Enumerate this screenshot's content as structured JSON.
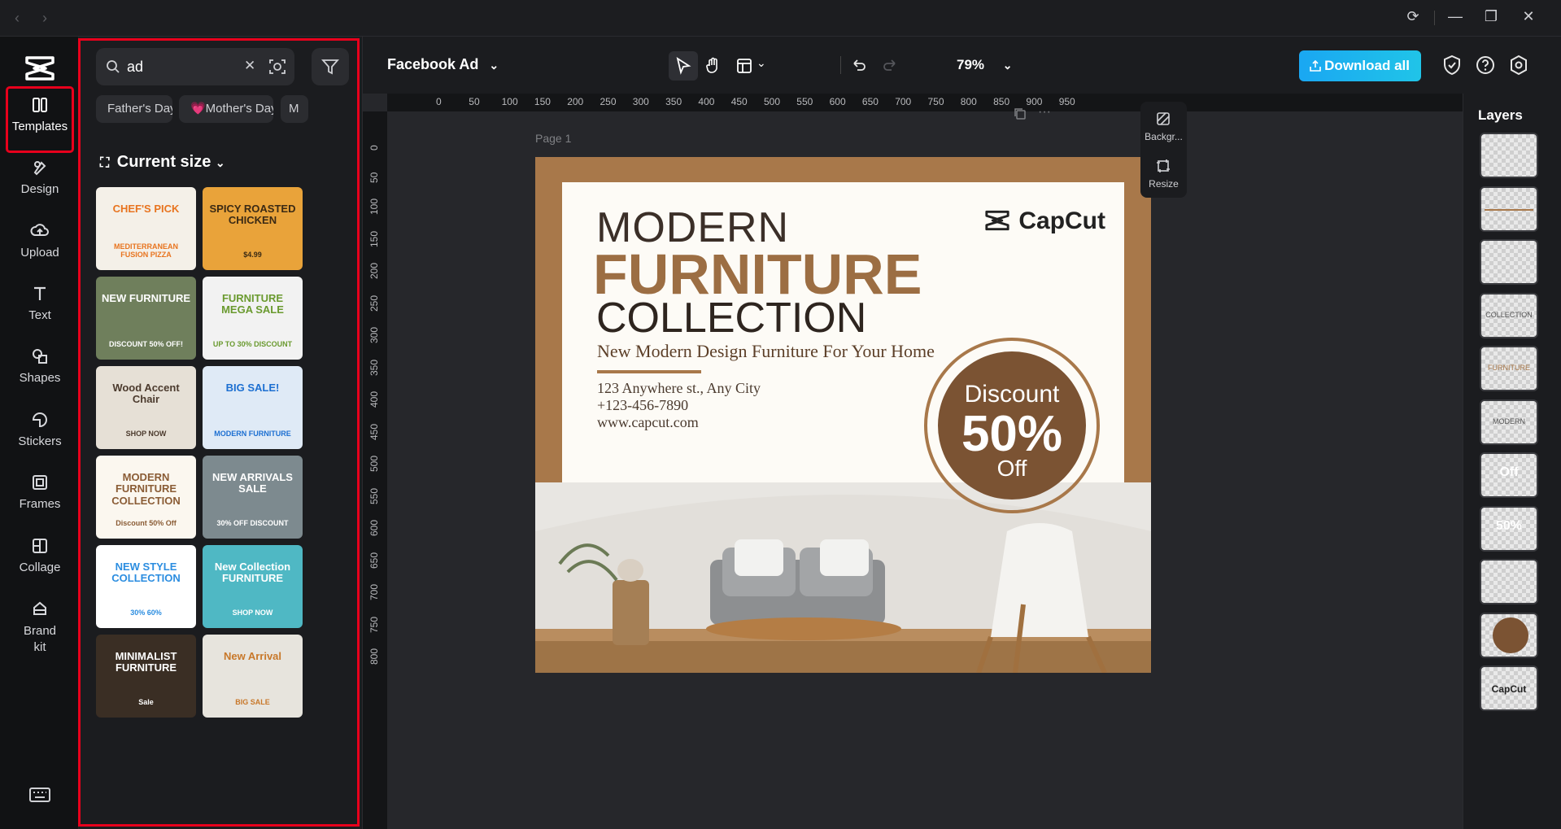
{
  "window": {
    "nav_back": "‹",
    "nav_forward": "›",
    "controls": [
      "refresh-icon",
      "minimize-icon",
      "restore-icon",
      "close-icon"
    ]
  },
  "rail": {
    "items": [
      {
        "label": "Templates",
        "icon": "templates-icon",
        "active": true
      },
      {
        "label": "Design",
        "icon": "design-icon"
      },
      {
        "label": "Upload",
        "icon": "upload-icon"
      },
      {
        "label": "Text",
        "icon": "text-icon"
      },
      {
        "label": "Shapes",
        "icon": "shapes-icon"
      },
      {
        "label": "Stickers",
        "icon": "stickers-icon"
      },
      {
        "label": "Frames",
        "icon": "frames-icon"
      },
      {
        "label": "Collage",
        "icon": "collage-icon"
      },
      {
        "label": "Brand kit",
        "icon": "brand-kit-icon"
      }
    ]
  },
  "panel": {
    "search_value": "ad",
    "chips": [
      "Father's Day",
      "💗Mother's Day",
      "M"
    ],
    "section_title": "Current size",
    "templates": [
      {
        "title": "CHEF'S PICK",
        "sub": "MEDITERRANEAN FUSION PIZZA",
        "bg": "#f4f0e8",
        "accent": "#e8741f"
      },
      {
        "title": "SPICY ROASTED CHICKEN",
        "sub": "$4.99",
        "bg": "#e9a33a",
        "accent": "#3b2a14"
      },
      {
        "title": "NEW FURNITURE",
        "sub": "DISCOUNT 50% OFF!",
        "bg": "#6f7f5c",
        "accent": "#ffffff"
      },
      {
        "title": "FURNITURE MEGA SALE",
        "sub": "UP TO 30% DISCOUNT",
        "bg": "#f2f2f2",
        "accent": "#6a9a2f"
      },
      {
        "title": "Wood Accent Chair",
        "sub": "SHOP NOW",
        "bg": "#e6e0d6",
        "accent": "#4b3a2d"
      },
      {
        "title": "BIG SALE!",
        "sub": "MODERN FURNITURE",
        "bg": "#dfeaf6",
        "accent": "#1c6fd1"
      },
      {
        "title": "MODERN FURNITURE COLLECTION",
        "sub": "Discount 50% Off",
        "bg": "#fbf7ef",
        "accent": "#8a5c35"
      },
      {
        "title": "NEW ARRIVALS SALE",
        "sub": "30% OFF DISCOUNT",
        "bg": "#7d8a8f",
        "accent": "#ffffff"
      },
      {
        "title": "NEW STYLE COLLECTION",
        "sub": "30% 60%",
        "bg": "#ffffff",
        "accent": "#2b8de0"
      },
      {
        "title": "New Collection FURNITURE",
        "sub": "SHOP NOW",
        "bg": "#4fb8c4",
        "accent": "#ffffff"
      },
      {
        "title": "MINIMALIST FURNITURE",
        "sub": "Sale",
        "bg": "#3a2e24",
        "accent": "#ffffff"
      },
      {
        "title": "New Arrival",
        "sub": "BIG SALE",
        "bg": "#e7e4dd",
        "accent": "#c8782a"
      }
    ]
  },
  "topbar": {
    "doc_title": "Facebook Ad",
    "zoom": "79%",
    "download_label": "Download all"
  },
  "canvas": {
    "ruler_h": [
      "0",
      "50",
      "100",
      "150",
      "200",
      "250",
      "300",
      "350",
      "400",
      "450",
      "500",
      "550",
      "600",
      "650",
      "700",
      "750",
      "800",
      "850",
      "900",
      "950"
    ],
    "ruler_v": [
      "0",
      "50",
      "100",
      "150",
      "200",
      "250",
      "300",
      "350",
      "400",
      "450",
      "500",
      "550",
      "600",
      "650",
      "700",
      "750",
      "800"
    ],
    "page_label": "Page 1",
    "ad": {
      "line1": "MODERN",
      "line2": "FURNITURE",
      "line3": "COLLECTION",
      "subtitle": "New Modern Design Furniture For Your Home",
      "address": "123 Anywhere st., Any City",
      "phone": "+123-456-7890",
      "website": "www.capcut.com",
      "brand": "CapCut",
      "discount": "Discount",
      "percent": "50%",
      "off": "Off"
    }
  },
  "side_tools": {
    "background": "Backgr...",
    "resize": "Resize"
  },
  "layers": {
    "title": "Layers",
    "items": [
      {
        "label": "",
        "kind": "text-small"
      },
      {
        "label": "",
        "kind": "line"
      },
      {
        "label": "",
        "kind": "text-small"
      },
      {
        "label": "COLLECTION",
        "kind": "text"
      },
      {
        "label": "FURNITURE",
        "kind": "text-brown"
      },
      {
        "label": "MODERN",
        "kind": "text"
      },
      {
        "label": "Off",
        "kind": "text-white"
      },
      {
        "label": "50%",
        "kind": "text-white"
      },
      {
        "label": "",
        "kind": "empty"
      },
      {
        "label": "",
        "kind": "circle"
      },
      {
        "label": "CapCut",
        "kind": "logo"
      }
    ]
  },
  "colors": {
    "accent_red": "#e8001c",
    "download_blue": "#1aa7f2",
    "ad_brown": "#a8784a",
    "circle_brown": "#7b5333"
  }
}
